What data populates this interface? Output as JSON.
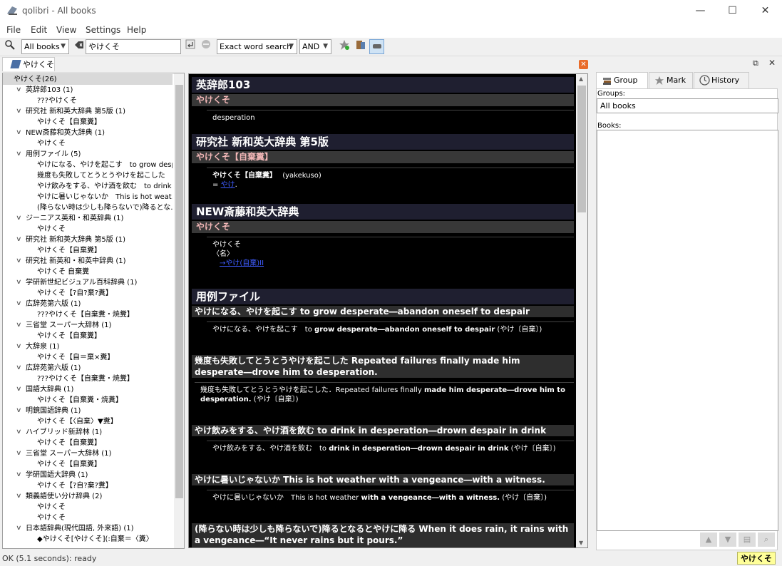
{
  "window": {
    "title": "qolibri - All books",
    "minimize": "—",
    "maximize": "☐",
    "close": "✕"
  },
  "menu": [
    "File",
    "Edit",
    "View",
    "Settings",
    "Help"
  ],
  "toolbar": {
    "book_select": "All books",
    "search_value": "やけくそ",
    "search_method": "Exact word search",
    "logic": "AND"
  },
  "left_tab": {
    "label": "やけくそ"
  },
  "tree": [
    {
      "label": "やけくそ(26)",
      "level": 0,
      "selected": true
    },
    {
      "label": "英辞郎103 (1)",
      "level": 1
    },
    {
      "label": "???やけくそ",
      "level": 2
    },
    {
      "label": "研究社 新和英大辞典 第5版 (1)",
      "level": 1
    },
    {
      "label": "やけくそ【自棄糞】",
      "level": 2
    },
    {
      "label": "NEW斎藤和英大辞典 (1)",
      "level": 1
    },
    {
      "label": "やけくそ",
      "level": 2
    },
    {
      "label": "用例ファイル (5)",
      "level": 1
    },
    {
      "label": "やけになる、やけを起こす　to grow desp…",
      "level": 2
    },
    {
      "label": "幾度も失敗してとうとうやけを起こした　R…",
      "level": 2
    },
    {
      "label": "やけ飲みをする、やけ酒を飲む　to drink i…",
      "level": 2
    },
    {
      "label": "やけに暑いじゃないか　This is hot weat…",
      "level": 2
    },
    {
      "label": "(降らない時は少しも降らないで)降るとな…",
      "level": 2
    },
    {
      "label": "ジーニアス英和・和英辞典 (1)",
      "level": 1
    },
    {
      "label": "やけくそ",
      "level": 2
    },
    {
      "label": "研究社 新和英大辞典 第5版 (1)",
      "level": 1
    },
    {
      "label": "やけくそ【自棄糞】",
      "level": 2
    },
    {
      "label": "研究社 新英和・和英中辞典 (1)",
      "level": 1
    },
    {
      "label": "やけくそ 自棄糞",
      "level": 2
    },
    {
      "label": "学研新世紀ビジュアル百科辞典 (1)",
      "level": 1
    },
    {
      "label": "やけくそ【?自?棄?糞】",
      "level": 2
    },
    {
      "label": "広辞苑第六版 (1)",
      "level": 1
    },
    {
      "label": "???やけくそ【自棄糞・焼糞】",
      "level": 2
    },
    {
      "label": "三省堂 スーパー大辞林 (1)",
      "level": 1
    },
    {
      "label": "やけくそ【自棄糞】",
      "level": 2
    },
    {
      "label": "大辞泉 (1)",
      "level": 1
    },
    {
      "label": "やけくそ【自＝棄×糞】",
      "level": 2
    },
    {
      "label": "広辞苑第六版 (1)",
      "level": 1
    },
    {
      "label": "???やけくそ【自棄糞・焼糞】",
      "level": 2
    },
    {
      "label": "国語大辞典 (1)",
      "level": 1
    },
    {
      "label": "やけくそ【自棄糞・焼糞】",
      "level": 2
    },
    {
      "label": "明鏡国語辞典 (1)",
      "level": 1
    },
    {
      "label": "やけくそ【〈自棄〉▼糞】",
      "level": 2
    },
    {
      "label": "ハイブリッド新辞林 (1)",
      "level": 1
    },
    {
      "label": "やけくそ【自棄糞】",
      "level": 2
    },
    {
      "label": "三省堂 スーパー大辞林 (1)",
      "level": 1
    },
    {
      "label": "やけくそ【自棄糞】",
      "level": 2
    },
    {
      "label": "学研国語大辞典 (1)",
      "level": 1
    },
    {
      "label": "やけくそ【?自?棄?糞】",
      "level": 2
    },
    {
      "label": "類義語使い分け辞典 (2)",
      "level": 1
    },
    {
      "label": "やけくそ",
      "level": 2
    },
    {
      "label": "やけくそ",
      "level": 2
    },
    {
      "label": "日本語辞典(現代国語, 外来語) (1)",
      "level": 1
    },
    {
      "label": "◆やけくそ[やけくそ](:自棄＝〈糞〉",
      "level": 2
    }
  ],
  "content": {
    "d1_title": "英辞郎103",
    "d1_sub": "やけくそ",
    "d1_body": "desperation",
    "d2_title": "研究社 新和英大辞典 第5版",
    "d2_sub": "やけくそ【自棄糞】",
    "d2_line1_a": "やけくそ【自棄糞】",
    "d2_line1_b": "(yakekuso)",
    "d2_line2_a": "= ",
    "d2_link": "やけ",
    "d2_line2_b": ".",
    "d3_title": "NEW斎藤和英大辞典",
    "d3_sub": "やけくそ",
    "d3_l1": "やけくそ",
    "d3_l2": "〈名〉",
    "d3_link": "→やけ(自棄)II",
    "d4_title": "用例ファイル",
    "ex1_head": "やけになる、やけを起こす to grow desperate―abandon oneself to despair",
    "ex1_jp": "やけになる、やけを起こす　to ",
    "ex1_en": "grow desperate―abandon oneself to despair",
    "ex1_tail": " (やけ〔自棄〕)",
    "ex2_head": "幾度も失敗してとうとうやけを起こした Repeated failures finally made him desperate―drove him to desperation.",
    "ex2_a": "幾度も失敗してとうとうやけを起こした．Repeated failures finally ",
    "ex2_b": "made him desperate―drove him to desperation.",
    "ex2_c": " (やけ〔自棄〕)",
    "ex3_head": "やけ飲みをする、やけ酒を飲む to drink in desperation―drown despair in drink",
    "ex3_jp": "やけ飲みをする、やけ酒を飲む　to ",
    "ex3_en": "drink in desperation―drown despair in drink",
    "ex3_tail": " (やけ〔自棄〕)",
    "ex4_head": "やけに暑いじゃないか This is hot weather with a vengeance―with a witness.",
    "ex4_jp": "やけに暑いじゃないか　This is hot weather ",
    "ex4_en": "with a vengeance―with a witness.",
    "ex4_tail": " (やけ〔自棄〕)",
    "ex5_head": "(降らない時は少しも降らないで)降るとなるとやけに降る When it does rain, it rains with a vengeance―“It never rains but it pours.”"
  },
  "right": {
    "tabs": [
      "Group",
      "Mark",
      "History"
    ],
    "groups_label": "Groups:",
    "groups_value": "All books",
    "books_label": "Books:"
  },
  "status": {
    "text": "OK (5.1 seconds): ready",
    "badge": "やけくそ",
    "badge_color": "#ffff99"
  }
}
